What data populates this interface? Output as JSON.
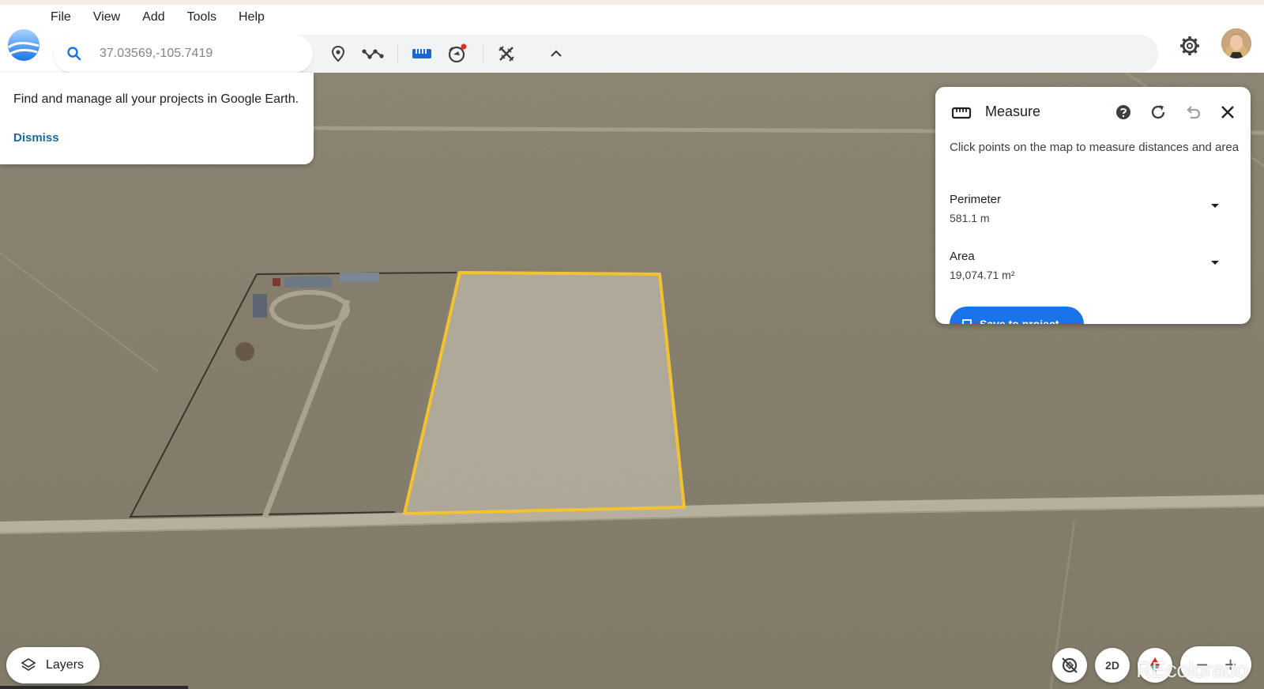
{
  "menu": [
    "File",
    "View",
    "Add",
    "Tools",
    "Help"
  ],
  "search": {
    "value": "37.03569,-105.7419"
  },
  "toolbar": {
    "icons": [
      "place-marker-icon",
      "draw-path-icon",
      "ruler-icon",
      "voyager-icon",
      "measure-tool-icon",
      "chevron-up-icon"
    ]
  },
  "projects_tip": {
    "message": "Find and manage all your projects in Google Earth.",
    "dismiss": "Dismiss"
  },
  "measure": {
    "title": "Measure",
    "description": "Click points on the map to measure distances and area",
    "perimeter_label": "Perimeter",
    "perimeter_value": "581.1 m",
    "area_label": "Area",
    "area_value": "19,074.71 m²",
    "save_label": "Save to project"
  },
  "bottom": {
    "layers_label": "Layers",
    "view_2d_label": "2D",
    "zoom_out": "−",
    "zoom_in": "+"
  },
  "watermark": "REcolorado",
  "colors": {
    "accent": "#1a73e8",
    "outline": "#f2c230",
    "notification_dot": "#d93025"
  }
}
